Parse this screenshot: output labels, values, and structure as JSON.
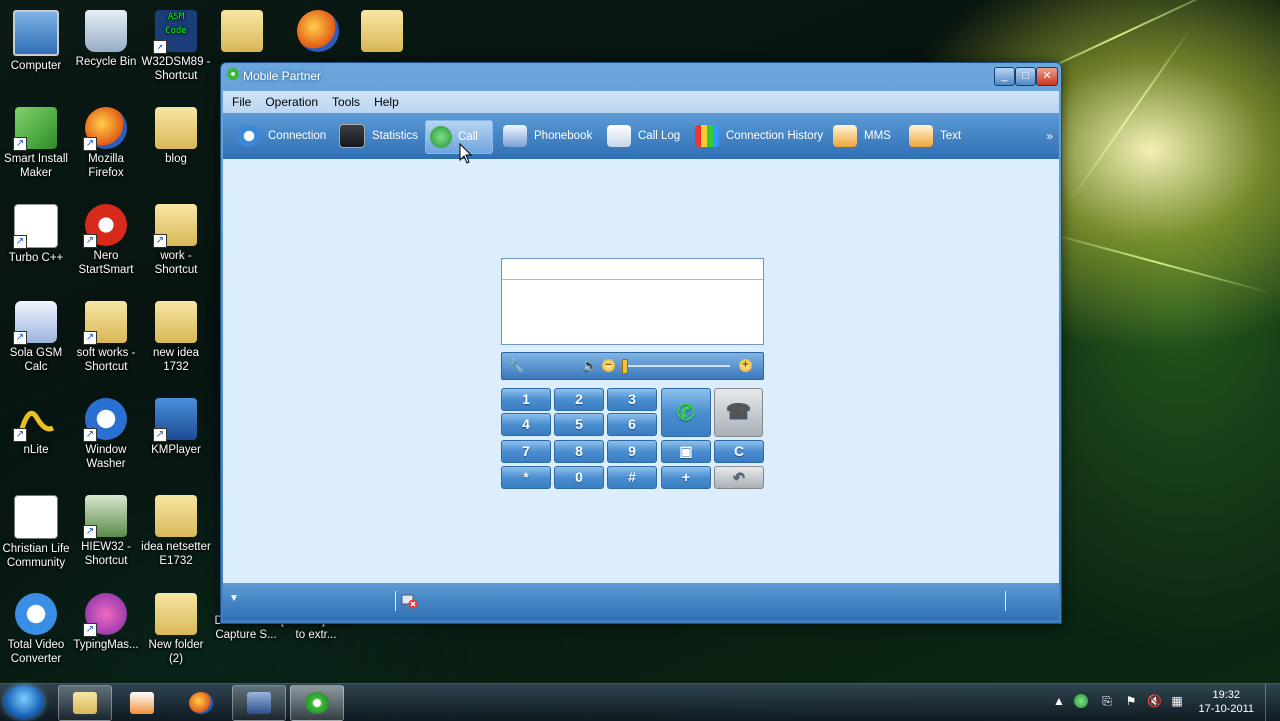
{
  "desktop": {
    "icons": [
      {
        "label": "Computer"
      },
      {
        "label": "Recycle Bin"
      },
      {
        "label": "W32DSM89 - Shortcut"
      },
      {
        "label": "Smart Install Maker"
      },
      {
        "label": "Mozilla Firefox"
      },
      {
        "label": "blog"
      },
      {
        "label": "Turbo C++"
      },
      {
        "label": "Nero StartSmart"
      },
      {
        "label": "work - Shortcut"
      },
      {
        "label": "Sola GSM Calc"
      },
      {
        "label": "soft works - Shortcut"
      },
      {
        "label": "new idea 1732"
      },
      {
        "label": "nLite"
      },
      {
        "label": "Window Washer"
      },
      {
        "label": "KMPlayer"
      },
      {
        "label": "Christian Life Community"
      },
      {
        "label": "HIEW32 - Shortcut"
      },
      {
        "label": "idea netsetter E1732"
      },
      {
        "label": "Total Video Converter"
      },
      {
        "label": "TypingMas..."
      },
      {
        "label": "New folder (2)"
      },
      {
        "label": "Debut Video Capture S..."
      },
      {
        "label": "[Tutorial] How to extr..."
      }
    ]
  },
  "window": {
    "title": "Mobile Partner",
    "controls": {
      "minimize": "_",
      "maximize": "□",
      "close": "✕"
    },
    "menu": [
      {
        "label": "File"
      },
      {
        "label": "Operation"
      },
      {
        "label": "Tools"
      },
      {
        "label": "Help"
      }
    ],
    "toolbar": [
      {
        "label": "Connection",
        "icon": "connection-icon"
      },
      {
        "label": "Statistics",
        "icon": "statistics-icon"
      },
      {
        "label": "Call",
        "icon": "call-icon",
        "active": true
      },
      {
        "label": "Phonebook",
        "icon": "phonebook-icon"
      },
      {
        "label": "Call Log",
        "icon": "call-log-icon"
      },
      {
        "label": "Connection History",
        "icon": "connection-history-icon"
      },
      {
        "label": "MMS",
        "icon": "mms-icon"
      },
      {
        "label": "Text",
        "icon": "text-icon"
      }
    ],
    "toolbar_more": "»",
    "dialer": {
      "number_value": "",
      "volume_level": 0.0,
      "keys": [
        "1",
        "2",
        "3",
        "4",
        "5",
        "6",
        "7",
        "8",
        "9",
        "*",
        "0",
        "#",
        "+"
      ],
      "call_key": "call-icon",
      "hangup_key": "hangup-icon",
      "contacts_key": "contacts-icon",
      "clear_key": "C",
      "backspace_key": "backspace-icon"
    }
  },
  "taskbar": {
    "clock_time": "19:32",
    "clock_date": "17-10-2011"
  },
  "colors": {
    "window_accent": "#3f7fc0",
    "content_bg": "#dcedfb",
    "call_green": "#3ad24a"
  }
}
